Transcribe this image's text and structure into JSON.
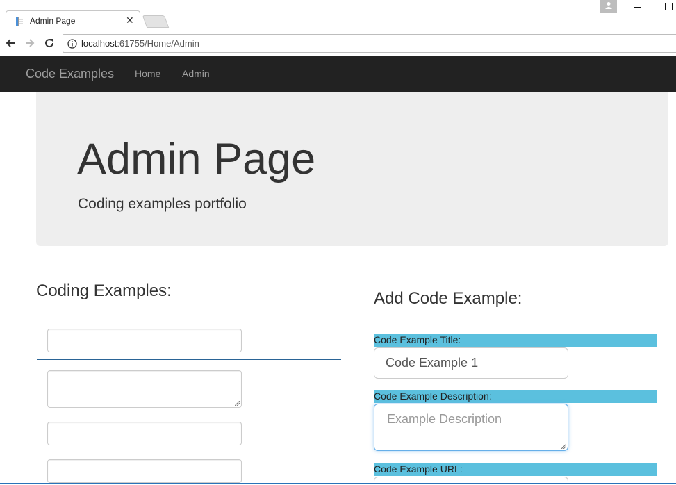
{
  "browser": {
    "tab_title": "Admin Page",
    "url_host": "localhost",
    "url_path": ":61755/Home/Admin"
  },
  "navbar": {
    "brand": "Code Examples",
    "links": [
      "Home",
      "Admin"
    ]
  },
  "jumbotron": {
    "title": "Admin Page",
    "subtitle": "Coding examples portfolio"
  },
  "left": {
    "heading": "Coding Examples:"
  },
  "right": {
    "heading": "Add Code Example:",
    "title_label": "Code Example Title:",
    "title_value": "Code Example 1",
    "description_label": "Code Example Description:",
    "description_placeholder": "Example Description",
    "url_label": "Code Example URL:"
  },
  "colors": {
    "navbar_bg": "#222222",
    "jumbotron_bg": "#eeeeee",
    "label_bg": "#5bc0de",
    "focus_border": "#66afe9"
  }
}
